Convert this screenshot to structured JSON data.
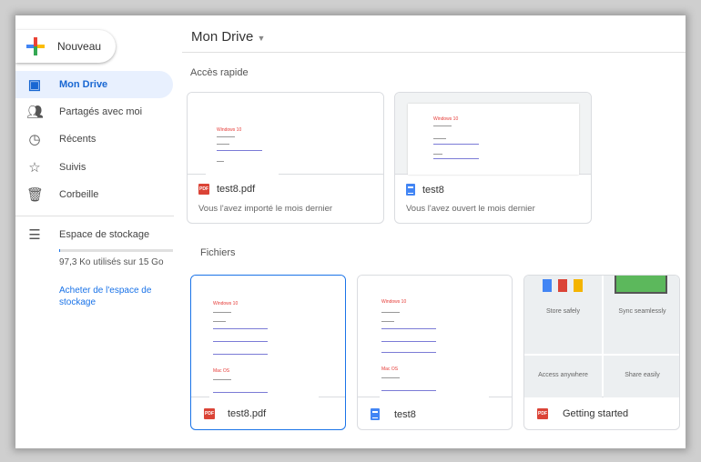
{
  "new_button": {
    "label": "Nouveau"
  },
  "sidebar": {
    "items": [
      {
        "label": "Mon Drive",
        "icon": "drive-icon",
        "active": true
      },
      {
        "label": "Partagés avec moi",
        "icon": "shared-icon"
      },
      {
        "label": "Récents",
        "icon": "clock-icon"
      },
      {
        "label": "Suivis",
        "icon": "star-icon"
      },
      {
        "label": "Corbeille",
        "icon": "trash-icon"
      }
    ],
    "storage": {
      "label": "Espace de stockage",
      "usage": "97,3 Ko utilisés sur 15 Go",
      "used_fraction": 0.0001,
      "buy_link": "Acheter de l'espace de stockage"
    }
  },
  "header": {
    "title": "Mon Drive"
  },
  "quick_access": {
    "title": "Accès rapide",
    "items": [
      {
        "name": "test8.pdf",
        "type": "pdf",
        "subtitle": "Vous l'avez importé le mois dernier"
      },
      {
        "name": "test8",
        "type": "doc",
        "subtitle": "Vous l'avez ouvert le mois dernier"
      }
    ]
  },
  "files": {
    "title": "Fichiers",
    "items": [
      {
        "name": "test8.pdf",
        "type": "pdf",
        "selected": true
      },
      {
        "name": "test8",
        "type": "doc"
      },
      {
        "name": "Getting started",
        "type": "pdf",
        "tiles": [
          "Store safely",
          "Sync seamlessly",
          "Access anywhere",
          "Share easily"
        ]
      }
    ]
  },
  "preview": {
    "heading": "Windows 10",
    "heading2": "Mac OS"
  },
  "colors": {
    "accent": "#1967d2",
    "active_bg": "#e8f0fe",
    "pdf": "#db4437",
    "doc": "#4285f4"
  }
}
